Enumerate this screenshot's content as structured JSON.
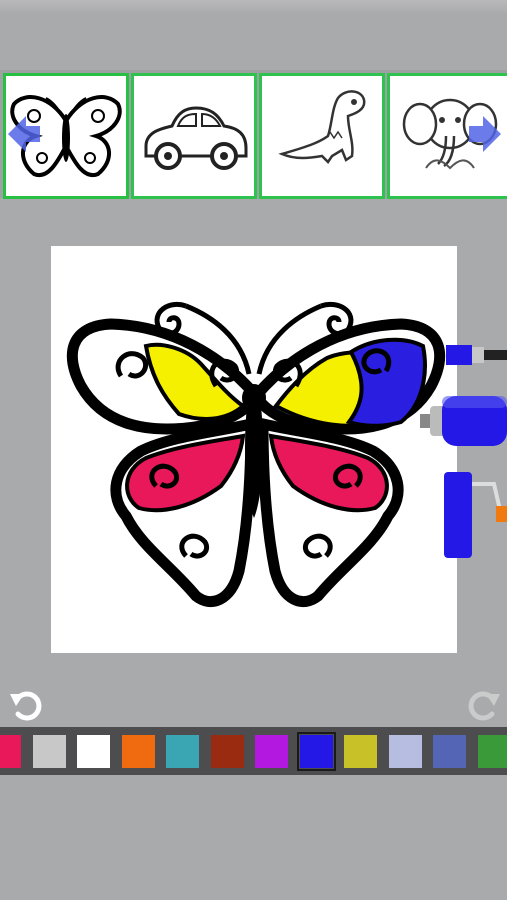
{
  "app": {
    "screen": "coloring-page"
  },
  "thumbnails": [
    {
      "subject": "butterfly",
      "selected": true
    },
    {
      "subject": "car",
      "selected": false
    },
    {
      "subject": "dinosaur",
      "selected": false
    },
    {
      "subject": "elephant",
      "selected": false
    }
  ],
  "canvas": {
    "subject": "butterfly",
    "fills": {
      "upper_wing_inner": "#f5f000",
      "upper_wing_outer_right": "#2a1ee0",
      "lower_wing": "#e8185a"
    }
  },
  "tools": [
    "paint-brush",
    "spray-can",
    "paint-roller"
  ],
  "tool_color": "#2418e6",
  "palette": {
    "selected_index": 7,
    "colors": [
      "#e8185a",
      "#c8c8c8",
      "#ffffff",
      "#f06a10",
      "#3aa6b4",
      "#9a2a10",
      "#b318e0",
      "#2418e6",
      "#c9c128",
      "#b7bde0",
      "#5565b5",
      "#3a9a3a"
    ]
  },
  "icons": {
    "undo": "undo-icon",
    "redo": "redo-icon",
    "prev": "arrow-left-icon",
    "next": "arrow-right-icon"
  }
}
